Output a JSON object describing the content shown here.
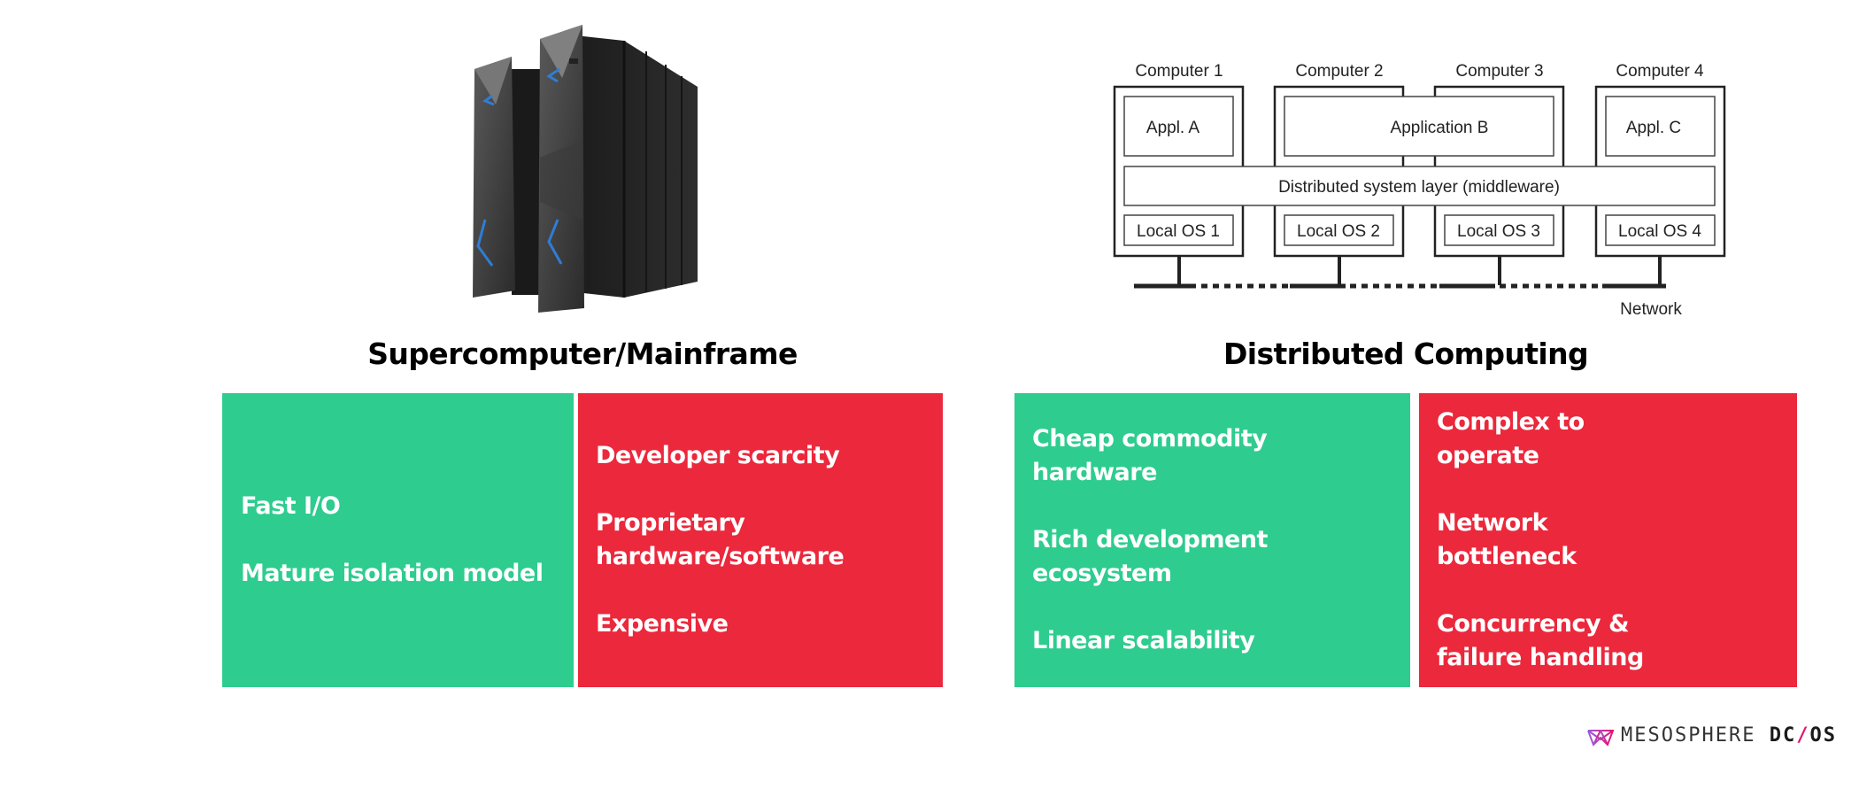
{
  "left": {
    "image": {
      "name": "mainframe-server-image"
    },
    "title": "Supercomputer/Mainframe",
    "pros": [
      "Fast I/O",
      "Mature isolation model"
    ],
    "cons": [
      "Developer scarcity",
      "Proprietary hardware/software",
      "Expensive"
    ]
  },
  "right": {
    "diagram": {
      "computers": [
        "Computer 1",
        "Computer 2",
        "Computer 3",
        "Computer 4"
      ],
      "applications": [
        "Appl. A",
        "Application B",
        "Appl. C"
      ],
      "middleware": "Distributed system layer (middleware)",
      "local_os": [
        "Local OS 1",
        "Local OS 2",
        "Local OS 3",
        "Local OS 4"
      ],
      "network_label": "Network"
    },
    "title": "Distributed Computing",
    "pros": [
      "Cheap commodity hardware",
      "Rich development ecosystem",
      "Linear scalability"
    ],
    "cons": [
      "Complex to operate",
      "Network bottleneck",
      "Concurrency & failure handling"
    ]
  },
  "colors": {
    "pros": "#2ECC8F",
    "cons": "#EB283C",
    "logo_accent": "#E3146E"
  },
  "footer": {
    "logo_word": "MESOSPHERE",
    "logo_product_a": "DC",
    "logo_slash": "/",
    "logo_product_b": "OS"
  }
}
